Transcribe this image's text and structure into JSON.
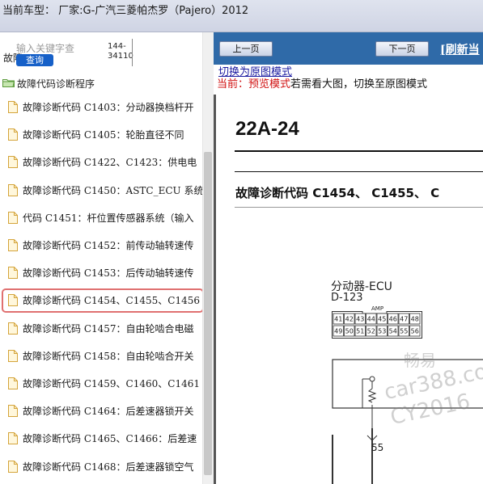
{
  "topbar": {
    "current_vehicle": "当前车型：  厂家:G-广汽三菱帕杰罗（Pajero）2012"
  },
  "sidebar": {
    "search_placeholder": "输入关键字查",
    "search_partial_text": "故障",
    "query_button": "查询",
    "code_box_text": [
      "144-",
      "34110"
    ],
    "tree_root": "故障代码诊断程序",
    "items": [
      "故障诊断代码 C1403：分动器换档杆开",
      "故障诊断代码 C1405：轮胎直径不同",
      "故障诊断代码 C1422、C1423：供电电",
      "故障诊断代码 C1450：ASTC_ECU 系统",
      "代码 C1451：杆位置传感器系统（输入",
      "故障诊断代码 C1452：前传动轴转速传",
      "故障诊断代码 C1453：后传动轴转速传",
      "故障诊断代码 C1454、C1455、C1456",
      "故障诊断代码 C1457：自由轮啮合电磁",
      "故障诊断代码 C1458：自由轮啮合开关",
      "故障诊断代码 C1459、C1460、C1461",
      "故障诊断代码 C1464：后差速器锁开关",
      "故障诊断代码 C1465、C1466：后差速",
      "故障诊断代码 C1468：后差速器锁空气"
    ],
    "selected_index": 7
  },
  "rightpane": {
    "prev_button": "上一页",
    "next_button": "下一页",
    "refresh_link": "[刷新当",
    "mode_link": "切换为原图模式",
    "mode_current_label": "当前：",
    "mode_current_value": "预览模式",
    "mode_hint": "若需看大图，切换至原图模式"
  },
  "document": {
    "page_number": "22A-24",
    "section_title": "故障诊断代码 C1454、 C1455、 C",
    "ecu_label": "分动器-ECU",
    "ecu_code": "D-123",
    "amp_text": "AMP",
    "connector_top_row": [
      "41",
      "42",
      "43",
      "44",
      "45",
      "46",
      "47",
      "48"
    ],
    "connector_bottom_row": [
      "49",
      "50",
      "51",
      "52",
      "53",
      "54",
      "55",
      "56"
    ],
    "pin_label": "55",
    "watermark_1": "畅易",
    "watermark_2": "car388.co",
    "watermark_3": "CY2016"
  },
  "colors": {
    "navbar": "#2f6aa8",
    "query_button": "#1660c8",
    "selected_outline": "#e07070",
    "mode_red": "#d01010"
  }
}
